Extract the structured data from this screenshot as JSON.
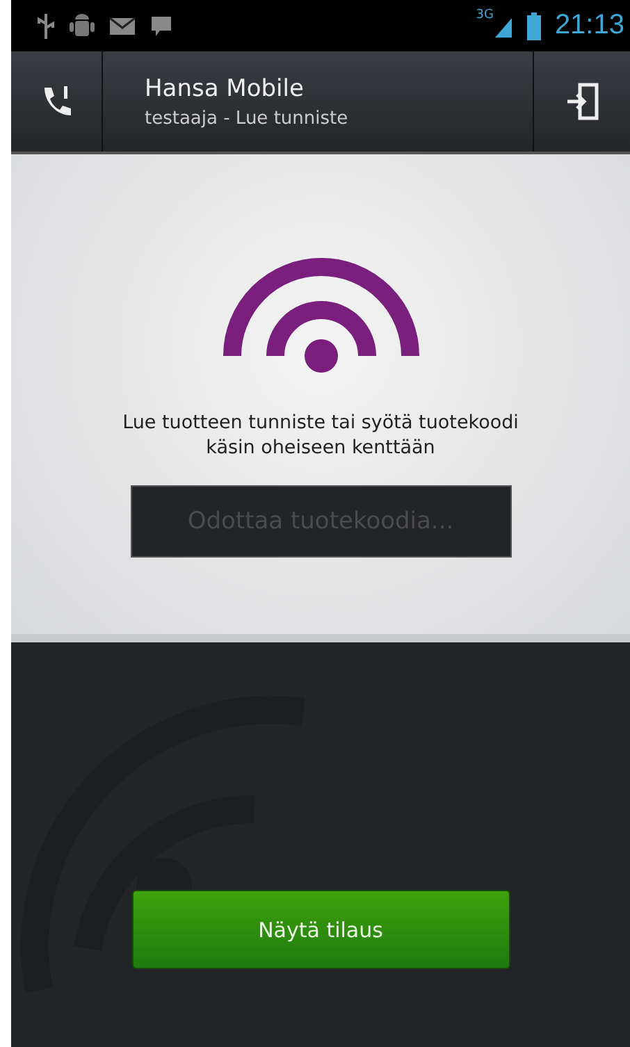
{
  "status_bar": {
    "network": "3G",
    "time": "21:13"
  },
  "action_bar": {
    "title": "Hansa Mobile",
    "subtitle": "testaaja - Lue tunniste"
  },
  "instruction": "Lue tuotteen tunniste tai syötä tuotekoodi käsin oheiseen kenttään",
  "code_field": {
    "placeholder": "Odottaa tuotekoodia..."
  },
  "buttons": [
    {
      "label": "Näytä tilaus"
    }
  ]
}
